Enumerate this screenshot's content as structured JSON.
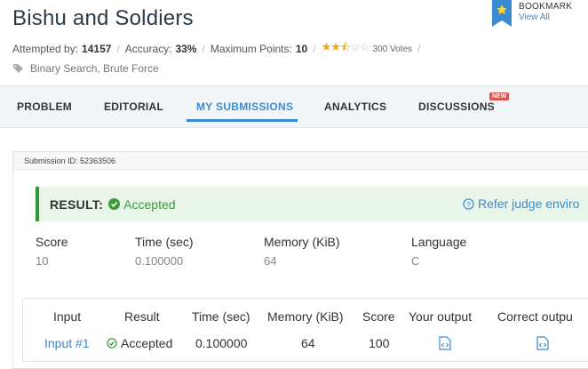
{
  "problem": {
    "title": "Bishu and Soldiers",
    "attempted_label": "Attempted by:",
    "attempted_value": "14157",
    "accuracy_label": "Accuracy:",
    "accuracy_value": "33%",
    "max_points_label": "Maximum Points:",
    "max_points_value": "10",
    "rating": 2.5,
    "votes": "300 Votes",
    "tags": "Binary Search, Brute Force"
  },
  "bookmark": {
    "title": "BOOKMARK",
    "link": "View All"
  },
  "tabs": [
    {
      "label": "PROBLEM"
    },
    {
      "label": "EDITORIAL"
    },
    {
      "label": "MY SUBMISSIONS"
    },
    {
      "label": "ANALYTICS"
    },
    {
      "label": "DISCUSSIONS"
    }
  ],
  "active_tab": "MY SUBMISSIONS",
  "new_badge": "NEW",
  "submission": {
    "id_text": "Submission ID: 52363506",
    "result_label": "RESULT:",
    "result_status": "Accepted",
    "judge_link": "Refer judge enviro",
    "stats": {
      "score_label": "Score",
      "score_value": "10",
      "time_label": "Time (sec)",
      "time_value": "0.100000",
      "memory_label": "Memory (KiB)",
      "memory_value": "64",
      "language_label": "Language",
      "language_value": "C"
    }
  },
  "table": {
    "headers": [
      "Input",
      "Result",
      "Time (sec)",
      "Memory (KiB)",
      "Score",
      "Your output",
      "Correct outpu"
    ],
    "rows": [
      {
        "input": "Input #1",
        "result": "Accepted",
        "time": "0.100000",
        "memory": "64",
        "score": "100"
      }
    ]
  },
  "colors": {
    "accent": "#3b8bd0",
    "success": "#2e9b37",
    "badge": "#d9534f",
    "star": "#f0a81b"
  },
  "icons": [
    "tag-icon",
    "bookmark-ribbon-icon",
    "star-icon",
    "check-circle-icon",
    "help-circle-icon",
    "code-file-icon"
  ]
}
